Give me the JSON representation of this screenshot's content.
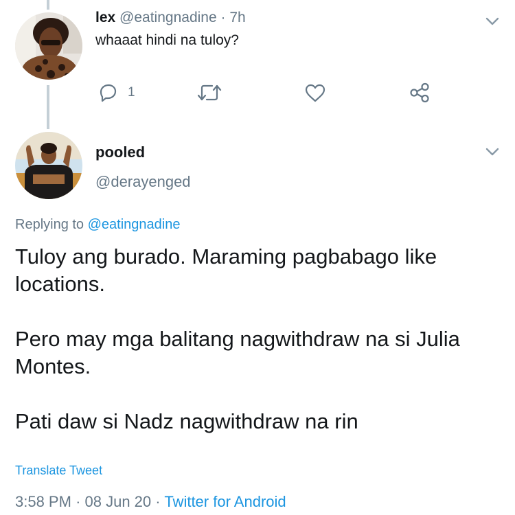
{
  "reply_tweet": {
    "display_name": "lex",
    "handle": "@eatingnadine",
    "separator": "·",
    "time_ago": "7h",
    "text": "whaaat hindi na tuloy?",
    "reply_count": "1"
  },
  "main_tweet": {
    "display_name": "pooled",
    "handle": "@derayenged",
    "replying_prefix": "Replying to",
    "replying_handle": "@eatingnadine",
    "paragraphs": [
      "Tuloy ang burado. Maraming pagbabago like locations.",
      "Pero may mga balitang nagwithdraw na si Julia Montes.",
      "Pati daw si Nadz nagwithdraw na rin"
    ],
    "translate_label": "Translate Tweet",
    "time": "3:58 PM",
    "separator": "·",
    "date": "08 Jun 20",
    "source": "Twitter for Android"
  },
  "colors": {
    "text": "#14171a",
    "muted": "#657786",
    "link": "#1b95e0",
    "thread_line": "#c4cfd6"
  },
  "icons": {
    "reply": "reply-icon",
    "retweet": "retweet-icon",
    "like": "heart-icon",
    "share": "share-icon",
    "menu": "chevron-down-icon"
  }
}
